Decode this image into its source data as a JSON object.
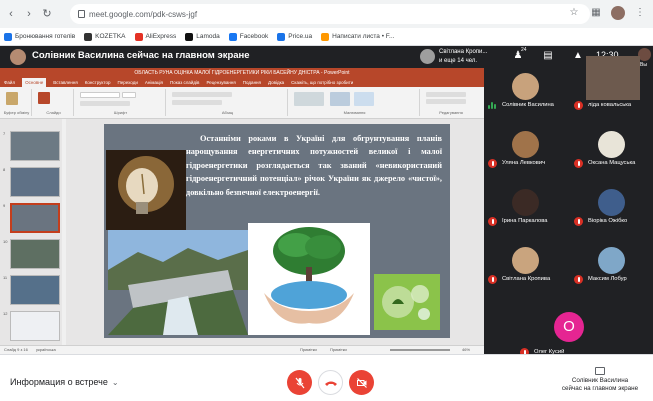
{
  "browser": {
    "url": "meet.google.com/pdk-csws-jgf",
    "bookmarks": [
      {
        "label": "Бронювання готелів",
        "color": "#1a73e8"
      },
      {
        "label": "KOZETKA",
        "color": "#333333"
      },
      {
        "label": "AliExpress",
        "color": "#e43225"
      },
      {
        "label": "Lamoda",
        "color": "#111111"
      },
      {
        "label": "Facebook",
        "color": "#1877f2"
      },
      {
        "label": "Price.ua",
        "color": "#1a73e8"
      },
      {
        "label": "Написати листа • F...",
        "color": "#ff9800"
      }
    ]
  },
  "meet": {
    "header_title": "Солівник Василина сейчас на главном экране",
    "chip_line1": "Світлана Кропи...",
    "chip_line2": "и еще 14 чел.",
    "participant_badge": "24",
    "time": "12:30",
    "you_label": "Вы",
    "meeting_info": "Информация о встрече",
    "presenting_line1": "Солівник Василина",
    "presenting_line2": "сейчас на главном экране"
  },
  "ppt": {
    "title": "ОБЛАСТЬ РУНА ОЦІНКА МАЛОЇ ГІДРОЕНЕРГЕТИКИ РІКИ БАСЕЙНУ ДНІСТРА - PowerPoint",
    "tabs": [
      "Файл",
      "Основне",
      "Вставлення",
      "Конструктор",
      "Переходи",
      "Анімація",
      "Показ слайдів",
      "Рецензування",
      "Подання",
      "Довідка",
      "Скажіть, що потрібно зробити"
    ],
    "ribbon_groups": [
      "Буфер обміну",
      "Слайди",
      "Шрифт",
      "Абзац",
      "Малювання",
      "Редагування"
    ],
    "status_left": "Слайд 9 з 16",
    "status_lang": "українська",
    "status_notes": "Примітки",
    "status_comments": "Примітки",
    "zoom": "46%",
    "thumb_numbers": [
      "7",
      "8",
      "9",
      "10",
      "11",
      "12"
    ],
    "slide_text": "Останніми роками в Україні для обгрунтування планів нарощування енергетичних потужностей великої і малої гідроенергетики розглядається так званий «невикористаний гідроенергетичний потенціал» річок України як джерело «чистої», довкільно безпечної електроенергії."
  },
  "participants": [
    {
      "name": "Солівник Василина",
      "speaking": true,
      "av_color": "#c8a27c"
    },
    {
      "name": "ліда ковальська",
      "speaking": false,
      "av_color": "#6d5a4e"
    },
    {
      "name": "Уляна Левкович",
      "speaking": false,
      "av_color": "#a0734a"
    },
    {
      "name": "Оксана Мацуська",
      "speaking": false,
      "av_color": "#e8e4d8"
    },
    {
      "name": "Ірина Паркалова",
      "speaking": false,
      "av_color": "#3b2a25"
    },
    {
      "name": "Віоріка Ожібко",
      "speaking": false,
      "av_color": "#3f5e8c"
    },
    {
      "name": "Світлана Кропива",
      "speaking": false,
      "av_color": "#c9a47e"
    },
    {
      "name": "Максим Лобур",
      "speaking": false,
      "av_color": "#7fa7c8"
    },
    {
      "name": "Олег Кусий",
      "speaking": false,
      "av_color": "#e52592",
      "initial": "О"
    }
  ],
  "colors": {
    "meet_bg": "#202124",
    "ppt_accent": "#b7472a",
    "mic_off": "#ea4335",
    "speaking": "#34a853"
  }
}
